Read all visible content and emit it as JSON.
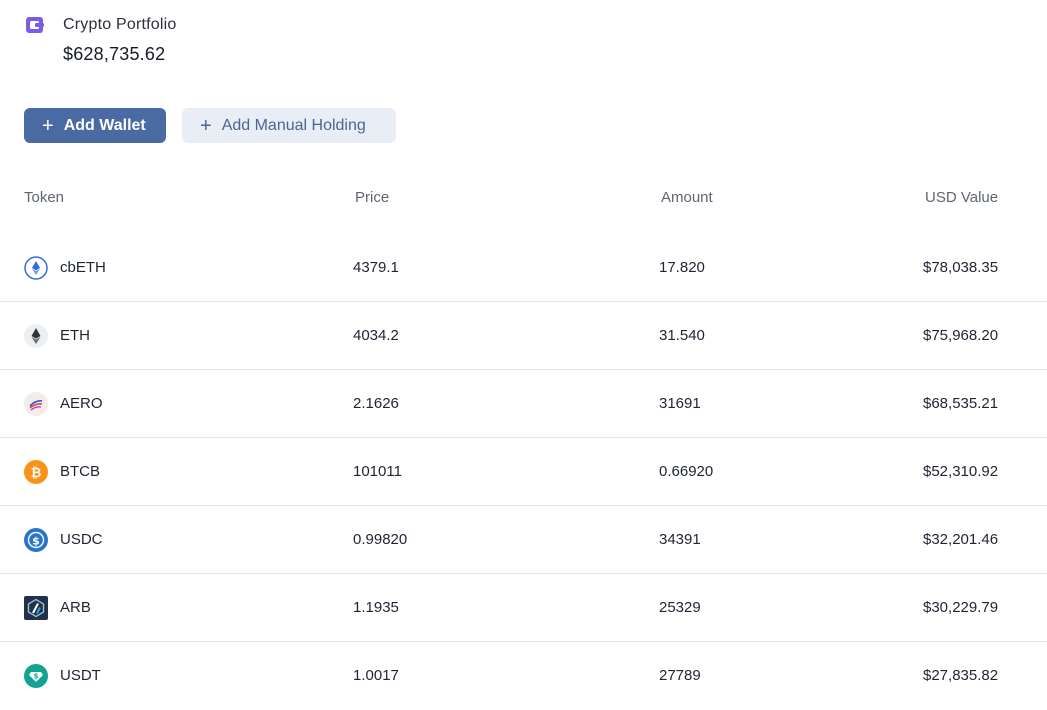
{
  "header": {
    "title": "Crypto Portfolio",
    "total_value": "$628,735.62",
    "icon": "wallet-icon",
    "icon_color": "#7b5ce6"
  },
  "actions": {
    "add_wallet_label": "Add Wallet",
    "add_manual_label": "Add Manual Holding",
    "primary_color": "#4a6aa3",
    "secondary_bg": "#e8edf6"
  },
  "table": {
    "columns": {
      "token": "Token",
      "price": "Price",
      "amount": "Amount",
      "usd_value": "USD Value"
    },
    "rows": [
      {
        "token": "cbETH",
        "price": "4379.1",
        "amount": "17.820",
        "usd_value": "$78,038.35",
        "icon": "cbeth-icon"
      },
      {
        "token": "ETH",
        "price": "4034.2",
        "amount": "31.540",
        "usd_value": "$75,968.20",
        "icon": "eth-icon"
      },
      {
        "token": "AERO",
        "price": "2.1626",
        "amount": "31691",
        "usd_value": "$68,535.21",
        "icon": "aero-icon"
      },
      {
        "token": "BTCB",
        "price": "101011",
        "amount": "0.66920",
        "usd_value": "$52,310.92",
        "icon": "btcb-icon"
      },
      {
        "token": "USDC",
        "price": "0.99820",
        "amount": "34391",
        "usd_value": "$32,201.46",
        "icon": "usdc-icon"
      },
      {
        "token": "ARB",
        "price": "1.1935",
        "amount": "25329",
        "usd_value": "$30,229.79",
        "icon": "arb-icon"
      },
      {
        "token": "USDT",
        "price": "1.0017",
        "amount": "27789",
        "usd_value": "$27,835.82",
        "icon": "usdt-icon"
      }
    ]
  }
}
